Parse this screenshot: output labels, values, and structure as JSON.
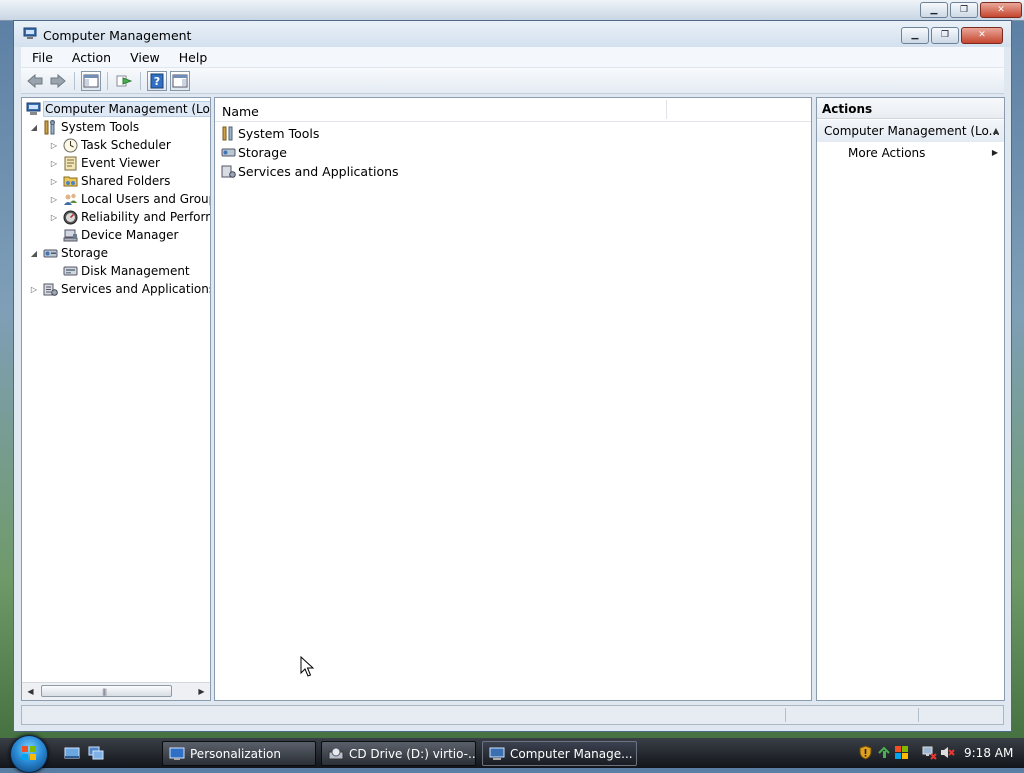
{
  "window": {
    "title": "Computer Management",
    "controls": {
      "minimize": "▁",
      "restore": "❐",
      "close": "✕"
    }
  },
  "menu": [
    "File",
    "Action",
    "View",
    "Help"
  ],
  "toolbar": {
    "buttons": [
      "back-icon",
      "forward-icon",
      "show-hide-tree-icon",
      "export-list-icon",
      "help-icon",
      "show-hide-action-pane-icon"
    ]
  },
  "tree": {
    "root": "Computer Management (Local)",
    "system_tools": "System Tools",
    "task_scheduler": "Task Scheduler",
    "event_viewer": "Event Viewer",
    "shared_folders": "Shared Folders",
    "local_users": "Local Users and Groups",
    "reliability": "Reliability and Performance",
    "device_manager": "Device Manager",
    "storage": "Storage",
    "disk_management": "Disk Management",
    "services_apps": "Services and Applications"
  },
  "content": {
    "column_name": "Name",
    "items": [
      "System Tools",
      "Storage",
      "Services and Applications"
    ]
  },
  "actions": {
    "title": "Actions",
    "section": "Computer Management (Lo...",
    "more_actions": "More Actions"
  },
  "taskbar": {
    "buttons": [
      {
        "label": "Personalization",
        "icon": "personalization-icon"
      },
      {
        "label": "CD Drive (D:) virtio-...",
        "icon": "cd-drive-icon"
      },
      {
        "label": "Computer Manage...",
        "icon": "computer-management-icon"
      }
    ],
    "clock": "9:18 AM"
  },
  "colors": {
    "title_gradient": "#d3e0ee",
    "selection": "#dfe9f5",
    "taskbar": "#1c2026"
  }
}
